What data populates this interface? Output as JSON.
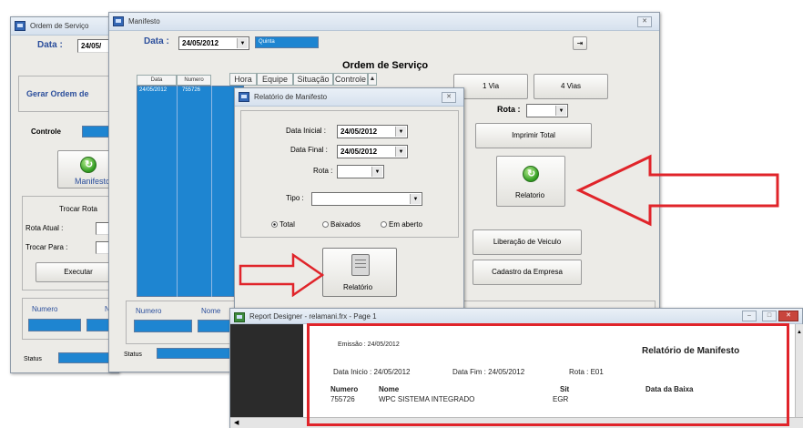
{
  "win_ordem": {
    "title": "Ordem de Serviço",
    "data_label": "Data :",
    "data_value": "24/05/",
    "gerar_label": "Gerar Ordem de",
    "controle_label": "Controle",
    "manifesto_label": "Manifesto",
    "trocar_rota": "Trocar Rota",
    "rota_atual": "Rota Atual :",
    "trocar_para": "Trocar Para :",
    "executar": "Executar",
    "numero": "Numero",
    "n": "N",
    "status": "Status"
  },
  "win_manifesto": {
    "title": "Manifesto",
    "data_label": "Data :",
    "data_value": "24/05/2012",
    "day_value": "Quinta",
    "heading": "Ordem de Serviço",
    "grid_headers": [
      "Data",
      "Numero",
      "Hora",
      "Equipe",
      "Situação",
      "Controle"
    ],
    "grid_row": [
      "24/05/2012",
      "755726"
    ],
    "btn_1via": "1 Via",
    "btn_4vias": "4 Vias",
    "rota_label": "Rota :",
    "btn_imprimir_total": "Imprimir Total",
    "btn_relatorio": "Relatorio",
    "btn_liberacao": "Liberação de Veiculo",
    "btn_cadastro": "Cadastro da Empresa",
    "numero": "Numero",
    "nome": "Nome",
    "status": "Status"
  },
  "dlg_relatorio": {
    "title": "Relatório de Manifesto",
    "data_inicial_label": "Data Inicial :",
    "data_inicial_value": "24/05/2012",
    "data_final_label": "Data Final :",
    "data_final_value": "24/05/2012",
    "rota_label": "Rota :",
    "tipo_label": "Tipo :",
    "radio_total": "Total",
    "radio_baixados": "Baixados",
    "radio_em_aberto": "Em aberto",
    "btn_relatorio": "Relatório"
  },
  "report_designer": {
    "title": "Report Designer - relamani.frx - Page 1",
    "emissao": "Emissão : 24/05/2012",
    "report_title": "Relatório de Manifesto",
    "data_inicio": "Data Inicio : 24/05/2012",
    "data_fim": "Data Fim : 24/05/2012",
    "rota": "Rota : E01",
    "col_numero": "Numero",
    "col_nome": "Nome",
    "col_sit": "Sit",
    "col_data_baixa": "Data da Baixa",
    "row_numero": "755726",
    "row_nome": "WPC SISTEMA INTEGRADO",
    "row_sit": "EGR"
  },
  "colors": {
    "highlight_red": "#e0242a",
    "grid_blue": "#1e85d1"
  }
}
